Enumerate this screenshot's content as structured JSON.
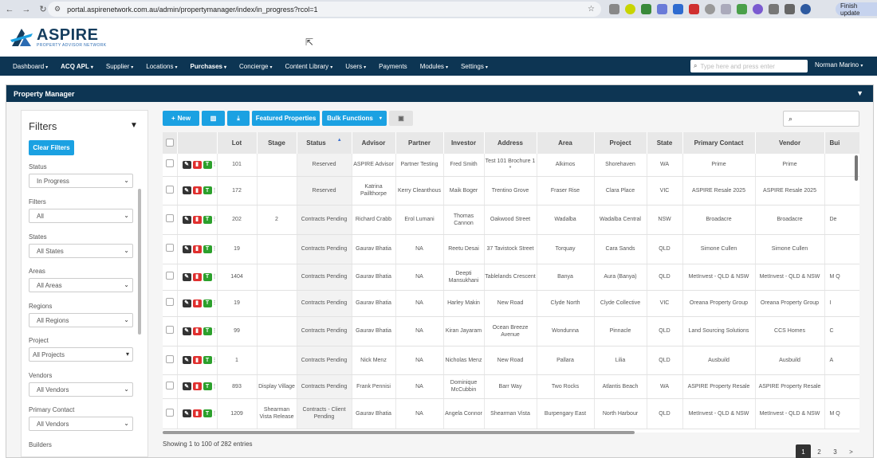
{
  "browser": {
    "url": "portal.aspirenetwork.com.au/admin/propertymanager/index/in_progress?rcol=1",
    "finish_update": "Finish update"
  },
  "logo": {
    "name": "ASPIRE",
    "tagline": "PROPERTY ADVISOR NETWORK"
  },
  "nav": {
    "items": [
      "Dashboard",
      "ACQ APL",
      "Supplier",
      "Locations",
      "Purchases",
      "Concierge",
      "Content Library",
      "Users",
      "Payments",
      "Modules",
      "Settings"
    ],
    "search_placeholder": "Type here and press enter",
    "user": "Norman Marino"
  },
  "panel": {
    "title": "Property Manager"
  },
  "filters": {
    "title": "Filters",
    "clear_label": "Clear Filters",
    "groups": [
      {
        "label": "Status",
        "value": "In Progress"
      },
      {
        "label": "Filters",
        "value": "All"
      },
      {
        "label": "States",
        "value": "All States"
      },
      {
        "label": "Areas",
        "value": "All Areas"
      },
      {
        "label": "Regions",
        "value": "All Regions"
      },
      {
        "label": "Project",
        "value": "All Projects"
      },
      {
        "label": "Vendors",
        "value": "All Vendors"
      },
      {
        "label": "Primary Contact",
        "value": "All Vendors"
      },
      {
        "label": "Builders",
        "value": ""
      }
    ]
  },
  "toolbar": {
    "new_label": "New",
    "featured_label": "Featured Properties",
    "bulk_label": "Bulk Functions"
  },
  "table": {
    "headers": [
      "",
      "",
      "Lot",
      "Stage",
      "Status",
      "Advisor",
      "Partner",
      "Investor",
      "Address",
      "Area",
      "Project",
      "State",
      "Primary Contact",
      "Vendor",
      "Bui"
    ],
    "rows": [
      [
        "101",
        "",
        "Reserved",
        "ASPIRE Advisor",
        "Partner Testing",
        "Fred Smith",
        "Test 101 Brochure 1 *",
        "Alkimos",
        "Shorehaven",
        "WA",
        "Prime",
        "Prime",
        ""
      ],
      [
        "172",
        "",
        "Reserved",
        "Katrina Paillthorpe",
        "Kerry Cleanthous",
        "Maik Boger",
        "Trentino Grove",
        "Fraser Rise",
        "Clara Place",
        "VIC",
        "ASPIRE Resale 2025",
        "ASPIRE Resale 2025",
        ""
      ],
      [
        "202",
        "2",
        "Contracts Pending",
        "Richard Crabb",
        "Erol Lumani",
        "Thomas Cannon",
        "Oakwood Street",
        "Wadalba",
        "Wadalba Central",
        "NSW",
        "Broadacre",
        "Broadacre",
        "De"
      ],
      [
        "19",
        "",
        "Contracts Pending",
        "Gaurav Bhatia",
        "NA",
        "Reetu Desai",
        "37 Tavistock Street",
        "Torquay",
        "Cara Sands",
        "QLD",
        "Simone Cullen",
        "Simone Cullen",
        ""
      ],
      [
        "1404",
        "",
        "Contracts Pending",
        "Gaurav Bhatia",
        "NA",
        "Deepti Mansukhani",
        "Tablelands Crescent",
        "Banya",
        "Aura (Banya)",
        "QLD",
        "MetInvest - QLD & NSW",
        "MetInvest - QLD & NSW",
        "M Q"
      ],
      [
        "19",
        "",
        "Contracts Pending",
        "Gaurav Bhatia",
        "NA",
        "Harley Makin",
        "New Road",
        "Clyde North",
        "Clyde Collective",
        "VIC",
        "Oreana Property Group",
        "Oreana Property Group",
        "I"
      ],
      [
        "99",
        "",
        "Contracts Pending",
        "Gaurav Bhatia",
        "NA",
        "Kiran Jayaram",
        "Ocean Breeze Avenue",
        "Wondunna",
        "Pinnacle",
        "QLD",
        "Land Sourcing Solutions",
        "CCS Homes",
        "C"
      ],
      [
        "1",
        "",
        "Contracts Pending",
        "Nick Menz",
        "NA",
        "Nicholas Menz",
        "New Road",
        "Pallara",
        "Lilia",
        "QLD",
        "Ausbuild",
        "Ausbuild",
        "A"
      ],
      [
        "893",
        "Display Village",
        "Contracts Pending",
        "Frank Pennisi",
        "NA",
        "Dominique McCubbin",
        "Barr Way",
        "Two Rocks",
        "Atlantis Beach",
        "WA",
        "ASPIRE Property Resale",
        "ASPIRE Property Resale",
        ""
      ],
      [
        "1209",
        "Shearman Vista Release",
        "Contracts - Client Pending",
        "Gaurav Bhatia",
        "NA",
        "Angela Connor",
        "Shearman Vista",
        "Burpengary East",
        "North Harbour",
        "QLD",
        "MetInvest - QLD & NSW",
        "MetInvest - QLD & NSW",
        "M Q"
      ]
    ]
  },
  "footer": {
    "showing": "Showing 1 to 100 of 282 entries",
    "pages": [
      "1",
      "2",
      "3",
      ">"
    ]
  }
}
